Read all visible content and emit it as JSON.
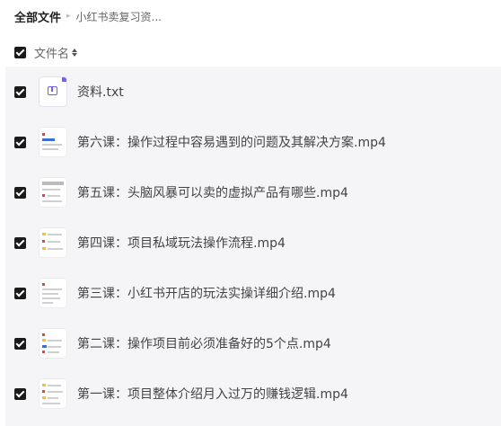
{
  "breadcrumb": {
    "root": "全部文件",
    "separator": "▸",
    "current": "小红书卖复习资..."
  },
  "header": {
    "label": "文件名",
    "all_checked": true
  },
  "files": [
    {
      "name": "资料.txt",
      "type": "txt",
      "icon": "txt-file-icon",
      "checked": true
    },
    {
      "name": "第六课：操作过程中容易遇到的问题及其解决方案.mp4",
      "type": "video",
      "icon": "video-thumbnail",
      "checked": true
    },
    {
      "name": "第五课：头脑风暴可以卖的虚拟产品有哪些.mp4",
      "type": "video",
      "icon": "video-thumbnail",
      "checked": true
    },
    {
      "name": "第四课：项目私域玩法操作流程.mp4",
      "type": "video",
      "icon": "video-thumbnail",
      "checked": true
    },
    {
      "name": "第三课：小红书开店的玩法实操详细介绍.mp4",
      "type": "video",
      "icon": "video-thumbnail",
      "checked": true
    },
    {
      "name": "第二课：操作项目前必须准备好的5个点.mp4",
      "type": "video",
      "icon": "video-thumbnail",
      "checked": true
    },
    {
      "name": "第一课：项目整体介绍月入过万的赚钱逻辑.mp4",
      "type": "video",
      "icon": "video-thumbnail",
      "checked": true
    }
  ],
  "colors": {
    "list_background": "#f5f5f7",
    "checkbox": "#1a1a1a",
    "txt_accent": "#7b5cf0"
  }
}
